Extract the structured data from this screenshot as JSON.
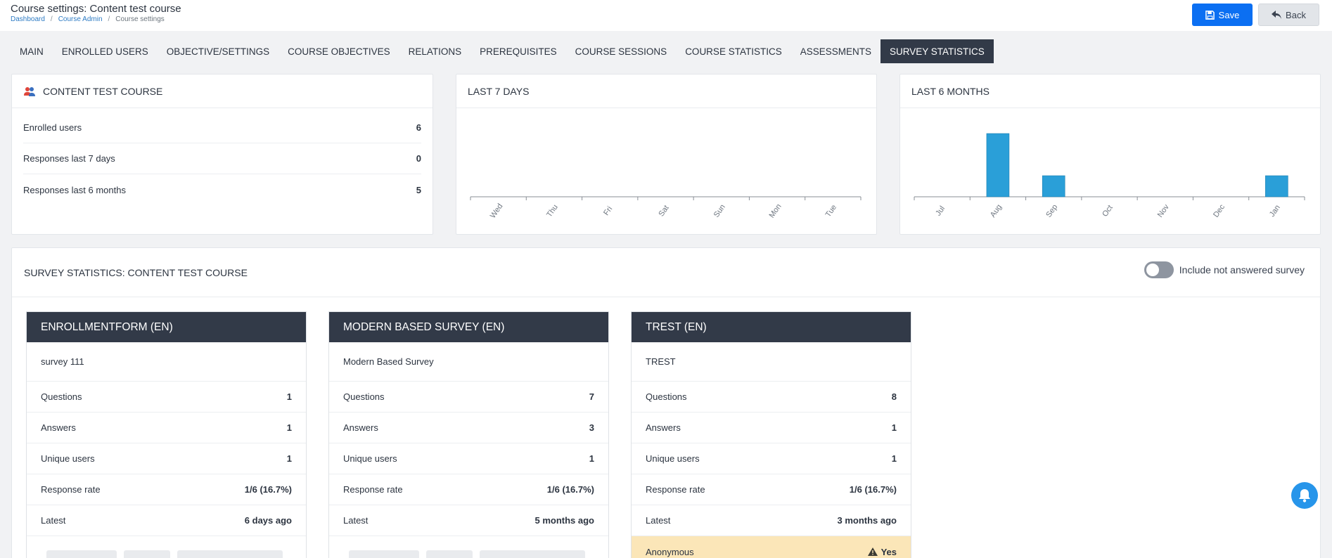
{
  "header": {
    "title": "Course settings: Content test course",
    "breadcrumb": [
      "Dashboard",
      "Course Admin",
      "Course settings"
    ],
    "save_label": "Save",
    "back_label": "Back"
  },
  "tabs": [
    {
      "label": "MAIN"
    },
    {
      "label": "ENROLLED USERS"
    },
    {
      "label": "OBJECTIVE/SETTINGS"
    },
    {
      "label": "COURSE OBJECTIVES"
    },
    {
      "label": "RELATIONS"
    },
    {
      "label": "PREREQUISITES"
    },
    {
      "label": "COURSE SESSIONS"
    },
    {
      "label": "COURSE STATISTICS"
    },
    {
      "label": "ASSESSMENTS"
    },
    {
      "label": "SURVEY STATISTICS",
      "active": true
    }
  ],
  "summary": {
    "title": "CONTENT TEST COURSE",
    "icon": "users-icon",
    "rows": [
      {
        "label": "Enrolled users",
        "value": "6"
      },
      {
        "label": "Responses last 7 days",
        "value": "0"
      },
      {
        "label": "Responses last 6 months",
        "value": "5"
      }
    ]
  },
  "chart_data": [
    {
      "type": "bar",
      "title": "LAST 7 DAYS",
      "categories": [
        "Wed",
        "Thu",
        "Fri",
        "Sat",
        "Sun",
        "Mon",
        "Tue"
      ],
      "values": [
        0,
        0,
        0,
        0,
        0,
        0,
        0
      ],
      "ylim": [
        0,
        3
      ],
      "grid": false,
      "color": "#2a9fd8"
    },
    {
      "type": "bar",
      "title": "LAST 6 MONTHS",
      "categories": [
        "Jul",
        "Aug",
        "Sep",
        "Oct",
        "Nov",
        "Dec",
        "Jan"
      ],
      "values": [
        0,
        3,
        1,
        0,
        0,
        0,
        1
      ],
      "ylim": [
        0,
        3
      ],
      "grid": false,
      "color": "#2a9fd8"
    }
  ],
  "survey_section": {
    "title": "SURVEY STATISTICS: CONTENT TEST COURSE",
    "toggle_label": "Include not answered survey",
    "toggle_on": false
  },
  "surveys": [
    {
      "title": "ENROLLMENTFORM (EN)",
      "description": "survey 111",
      "rows": [
        {
          "label": "Questions",
          "value": "1"
        },
        {
          "label": "Answers",
          "value": "1"
        },
        {
          "label": "Unique users",
          "value": "1"
        },
        {
          "label": "Response rate",
          "value": "1/6 (16.7%)"
        },
        {
          "label": "Latest",
          "value": "6 days ago"
        }
      ]
    },
    {
      "title": "MODERN BASED SURVEY (EN)",
      "description": "Modern Based Survey",
      "rows": [
        {
          "label": "Questions",
          "value": "7"
        },
        {
          "label": "Answers",
          "value": "3"
        },
        {
          "label": "Unique users",
          "value": "1"
        },
        {
          "label": "Response rate",
          "value": "1/6 (16.7%)"
        },
        {
          "label": "Latest",
          "value": "5 months ago"
        }
      ]
    },
    {
      "title": "TREST (EN)",
      "description": "TREST",
      "rows": [
        {
          "label": "Questions",
          "value": "8"
        },
        {
          "label": "Answers",
          "value": "1"
        },
        {
          "label": "Unique users",
          "value": "1"
        },
        {
          "label": "Response rate",
          "value": "1/6 (16.7%)"
        },
        {
          "label": "Latest",
          "value": "3 months ago"
        }
      ],
      "anonymous": {
        "label": "Anonymous",
        "value": "Yes",
        "icon": "warning-icon"
      }
    }
  ],
  "colors": {
    "accent": "#0b6ff2",
    "dark": "#323a48",
    "bar": "#2a9fd8",
    "notice": "#fbe6b8"
  }
}
